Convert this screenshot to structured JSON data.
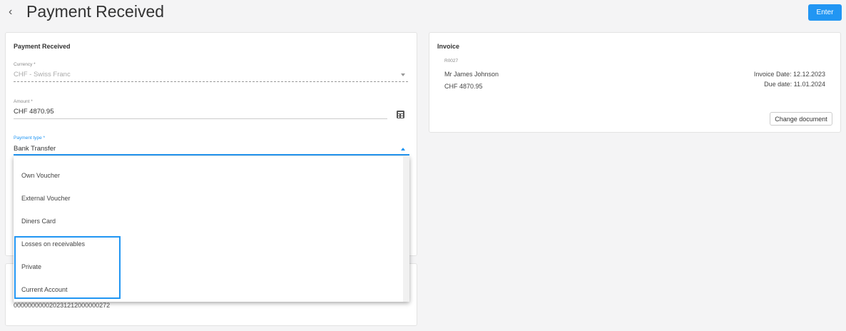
{
  "header": {
    "title": "Payment Received",
    "back_icon": "chevron-left-icon",
    "enter_label": "Enter",
    "accent_color": "#2196f3"
  },
  "payment_card": {
    "title": "Payment Received",
    "currency": {
      "label": "Currency *",
      "value": "CHF - Swiss Franc"
    },
    "amount": {
      "label": "Amount *",
      "value": "CHF 4870.95",
      "icon": "calculator-icon"
    },
    "payment_type": {
      "label": "Payment type *",
      "value": "Bank Transfer"
    },
    "reference_number": "000000000020231212000000272"
  },
  "dropdown": {
    "options": [
      "Own Voucher",
      "External Voucher",
      "Diners Card",
      "Losses on receivables",
      "Private",
      "Current Account"
    ]
  },
  "invoice_card": {
    "title": "Invoice",
    "number": "R0027",
    "customer": "Mr James Johnson",
    "amount": "CHF 4870.95",
    "invoice_date": "Invoice Date: 12.12.2023",
    "due_date": "Due date: 11.01.2024",
    "change_label": "Change document"
  }
}
